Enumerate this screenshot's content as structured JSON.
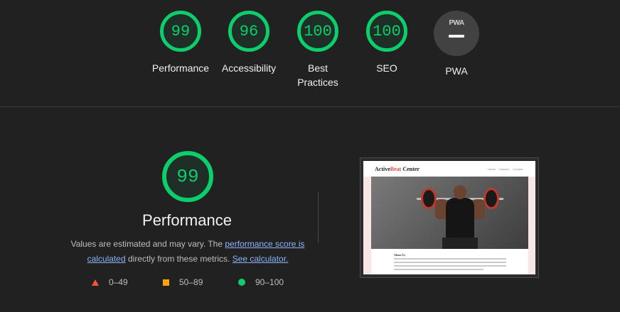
{
  "scores": [
    {
      "value": "99",
      "label": "Performance"
    },
    {
      "value": "96",
      "label": "Accessibility"
    },
    {
      "value": "100",
      "label": "Best Practices"
    },
    {
      "value": "100",
      "label": "SEO"
    }
  ],
  "pwa": {
    "badge_text": "PWA",
    "label": "PWA"
  },
  "performance": {
    "score": "99",
    "title": "Performance",
    "desc_prefix": "Values are estimated and may vary. The ",
    "link_score": "performance score is calculated",
    "desc_middle": " directly from these metrics. ",
    "link_calc": "See calculator."
  },
  "legend": [
    {
      "range": "0–49",
      "color": "#ff4e42",
      "shape": "triangle"
    },
    {
      "range": "50–89",
      "color": "#ffa400",
      "shape": "square"
    },
    {
      "range": "90–100",
      "color": "#0cce6b",
      "shape": "circle"
    }
  ],
  "screenshot": {
    "brand_part1": "Active",
    "brand_part2": "Beat",
    "brand_part3": " Center",
    "nav": [
      "Home",
      "Classes",
      "Contact"
    ],
    "about_title": "About Us"
  },
  "colors": {
    "pass": "#0cce6b",
    "average": "#ffa400",
    "fail": "#ff4e42",
    "background": "#212121"
  }
}
